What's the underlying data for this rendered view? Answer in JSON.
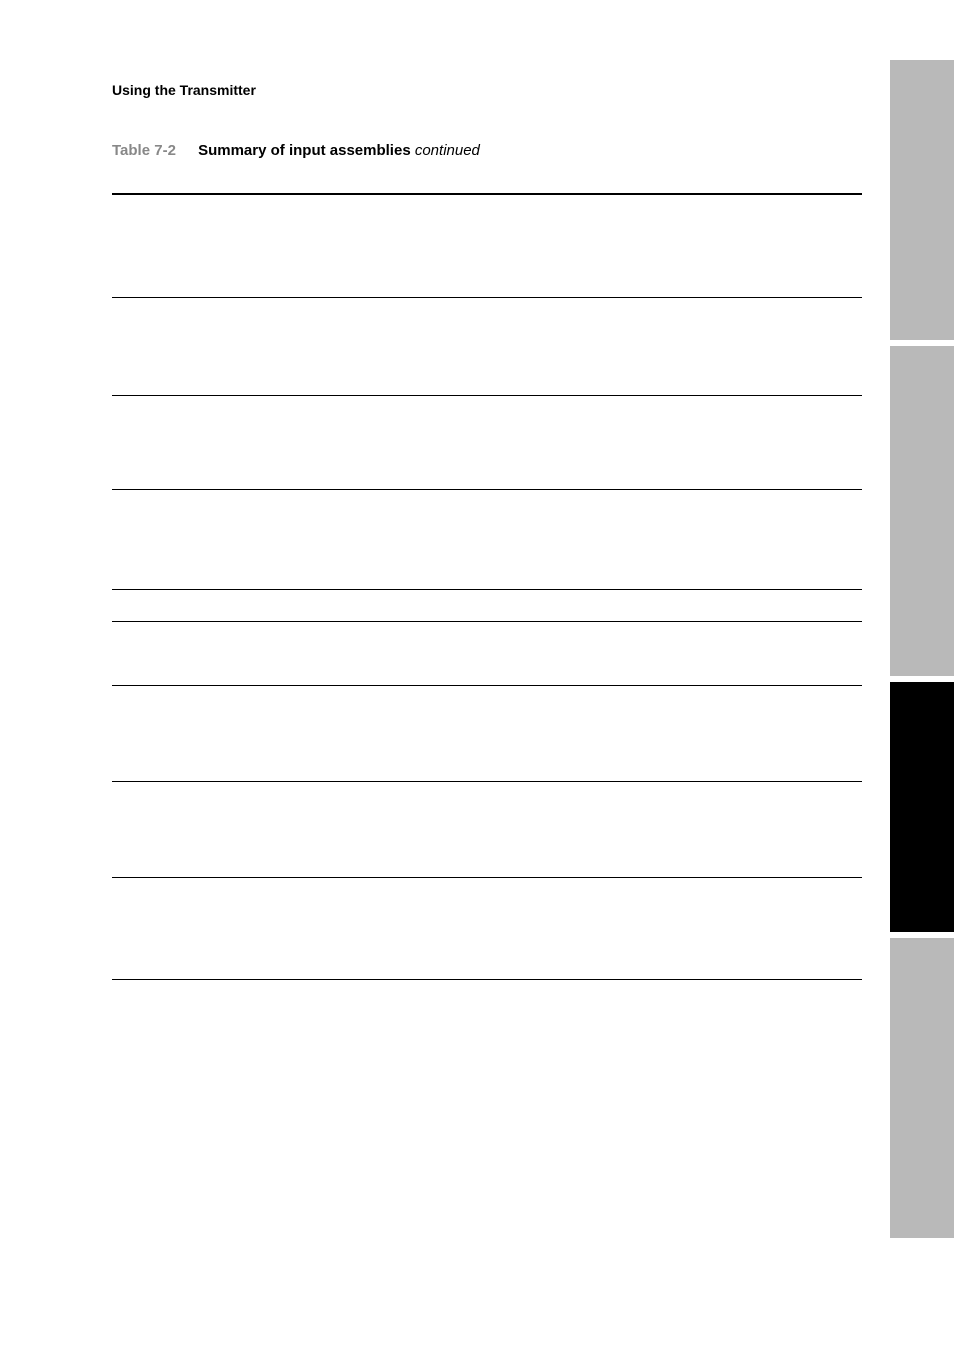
{
  "header": {
    "title": "Using the Transmitter"
  },
  "table": {
    "number": "Table 7-2",
    "title": "Summary of input assemblies",
    "continued": "continued"
  }
}
